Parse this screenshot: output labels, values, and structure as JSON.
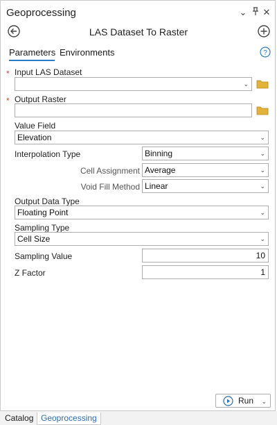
{
  "panel": {
    "title": "Geoprocessing",
    "controls": {
      "menu": "⌄",
      "pin": "⊥",
      "close": "✕"
    }
  },
  "tool": {
    "title": "LAS Dataset To Raster",
    "back_icon": "back-arrow-icon",
    "add_icon": "add-circle-icon"
  },
  "tabs": [
    {
      "label": "Parameters",
      "active": true
    },
    {
      "label": "Environments",
      "active": false
    }
  ],
  "help_icon": "question-circle-icon",
  "required_marker": "*",
  "params": {
    "input_las": {
      "label": "Input LAS Dataset",
      "value": ""
    },
    "output_raster": {
      "label": "Output Raster",
      "value": ""
    },
    "value_field": {
      "label": "Value Field",
      "value": "Elevation"
    },
    "interpolation_type": {
      "label": "Interpolation Type",
      "value": "Binning"
    },
    "cell_assignment": {
      "label": "Cell Assignment",
      "value": "Average"
    },
    "void_fill": {
      "label": "Void Fill Method",
      "value": "Linear"
    },
    "output_data_type": {
      "label": "Output Data Type",
      "value": "Floating Point"
    },
    "sampling_type": {
      "label": "Sampling Type",
      "value": "Cell Size"
    },
    "sampling_value": {
      "label": "Sampling Value",
      "value": "10"
    },
    "z_factor": {
      "label": "Z Factor",
      "value": "1"
    }
  },
  "run_button": {
    "label": "Run"
  },
  "bottom_tabs": [
    {
      "label": "Catalog",
      "active": false
    },
    {
      "label": "Geoprocessing",
      "active": true
    }
  ],
  "colors": {
    "accent": "#2b7dc8",
    "required": "#d24a2a",
    "folder": "#e2b23a",
    "run_icon": "#2b6db0"
  }
}
